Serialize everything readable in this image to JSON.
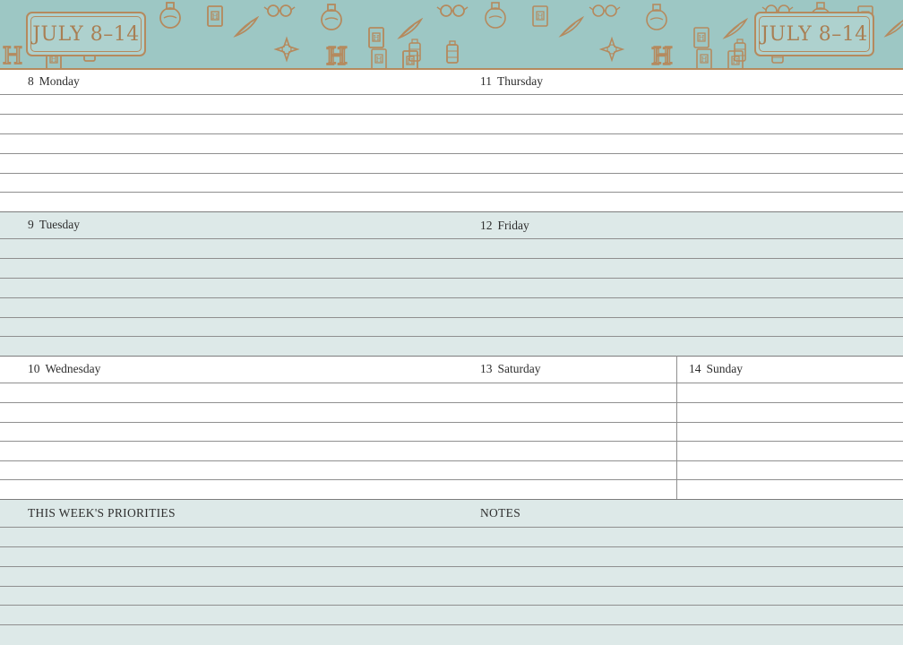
{
  "header": {
    "week_range": "JULY 8–14",
    "background_color": "#9dc7c4",
    "accent_color": "#b58a5e",
    "pattern_icons": [
      "potion-bottle-icon",
      "book-icon",
      "quill-icon",
      "glasses-icon",
      "compass-icon",
      "letter-h-icon",
      "lantern-icon"
    ]
  },
  "days": {
    "monday": {
      "num": "8",
      "name": "Monday"
    },
    "tuesday": {
      "num": "9",
      "name": "Tuesday"
    },
    "wednesday": {
      "num": "10",
      "name": "Wednesday"
    },
    "thursday": {
      "num": "11",
      "name": "Thursday"
    },
    "friday": {
      "num": "12",
      "name": "Friday"
    },
    "saturday": {
      "num": "13",
      "name": "Saturday"
    },
    "sunday": {
      "num": "14",
      "name": "Sunday"
    }
  },
  "bottom": {
    "priorities_label": "THIS WEEK'S PRIORITIES",
    "notes_label": "NOTES"
  },
  "colors": {
    "tint_band": "#dde9e8",
    "rule_line": "#8f8f8f"
  }
}
